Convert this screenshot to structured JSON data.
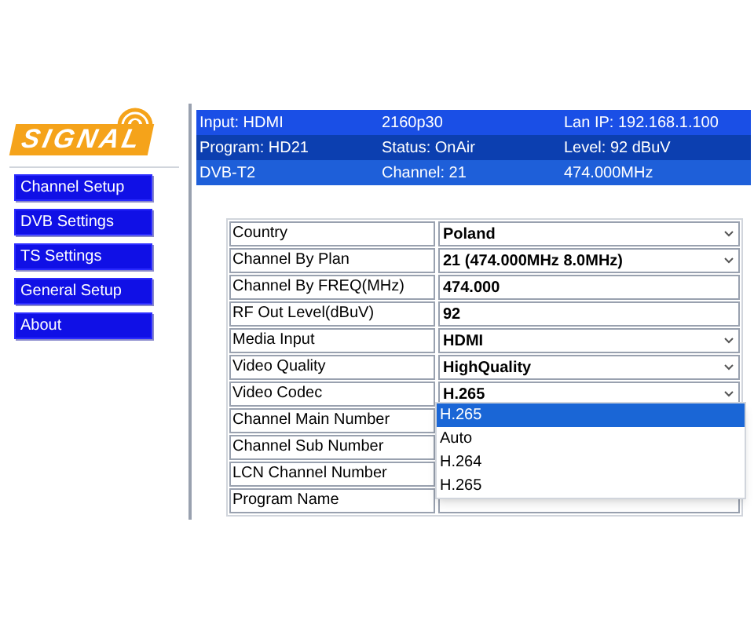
{
  "logo": {
    "text": "SIGNAL"
  },
  "sidebar": {
    "items": [
      {
        "label": "Channel Setup"
      },
      {
        "label": "DVB Settings"
      },
      {
        "label": "TS Settings"
      },
      {
        "label": "General Setup"
      },
      {
        "label": "About"
      }
    ]
  },
  "status": {
    "rows": [
      {
        "cells": [
          "Input: HDMI",
          "2160p30",
          "Lan IP: 192.168.1.100"
        ]
      },
      {
        "cells": [
          "Program: HD21",
          "Status: OnAir",
          "Level: 92 dBuV"
        ]
      },
      {
        "cells": [
          "DVB-T2",
          "Channel: 21",
          "474.000MHz"
        ]
      }
    ]
  },
  "form": {
    "rows": [
      {
        "label": "Country",
        "kind": "select",
        "value": "Poland"
      },
      {
        "label": "Channel By Plan",
        "kind": "select",
        "value": "21 (474.000MHz 8.0MHz)"
      },
      {
        "label": "Channel By FREQ(MHz)",
        "kind": "input",
        "value": "474.000"
      },
      {
        "label": "RF Out Level(dBuV)",
        "kind": "input",
        "value": "92"
      },
      {
        "label": "Media Input",
        "kind": "select",
        "value": "HDMI"
      },
      {
        "label": "Video Quality",
        "kind": "select",
        "value": "HighQuality"
      },
      {
        "label": "Video Codec",
        "kind": "select",
        "value": "H.265"
      },
      {
        "label": "Channel Main Number"
      },
      {
        "label": "Channel Sub Number"
      },
      {
        "label": "LCN Channel Number"
      },
      {
        "label": "Program Name",
        "kind": "input"
      }
    ]
  },
  "dropdown": {
    "options": [
      {
        "label": "H.265",
        "selected": true
      },
      {
        "label": "Auto",
        "selected": false
      },
      {
        "label": "H.264",
        "selected": false
      },
      {
        "label": "H.265",
        "selected": false
      }
    ]
  }
}
